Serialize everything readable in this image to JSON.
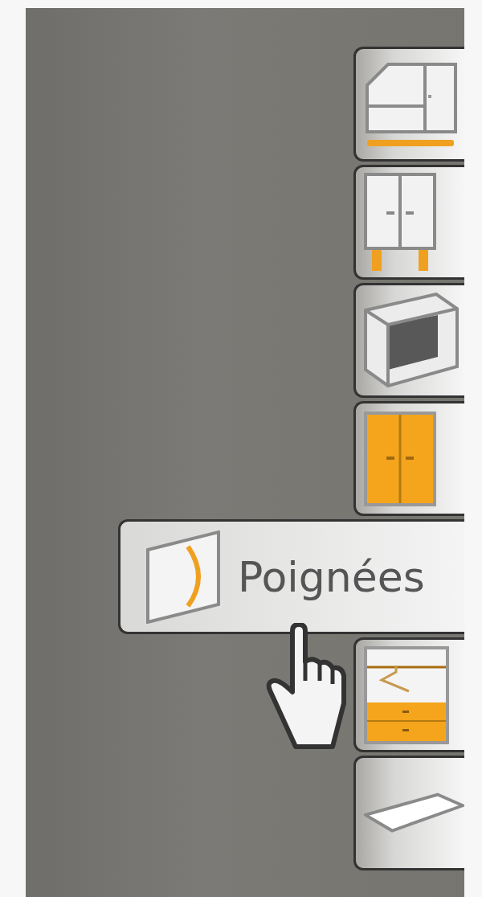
{
  "tabs": [
    {
      "kind": "corner-cabinet",
      "expanded": false
    },
    {
      "kind": "cabinet-legs",
      "expanded": false
    },
    {
      "kind": "open-box",
      "expanded": false
    },
    {
      "kind": "doors",
      "expanded": false
    },
    {
      "kind": "handle",
      "expanded": true,
      "label": "Poignées"
    },
    {
      "kind": "wardrobe",
      "expanded": false
    },
    {
      "kind": "shelf",
      "expanded": false
    }
  ]
}
